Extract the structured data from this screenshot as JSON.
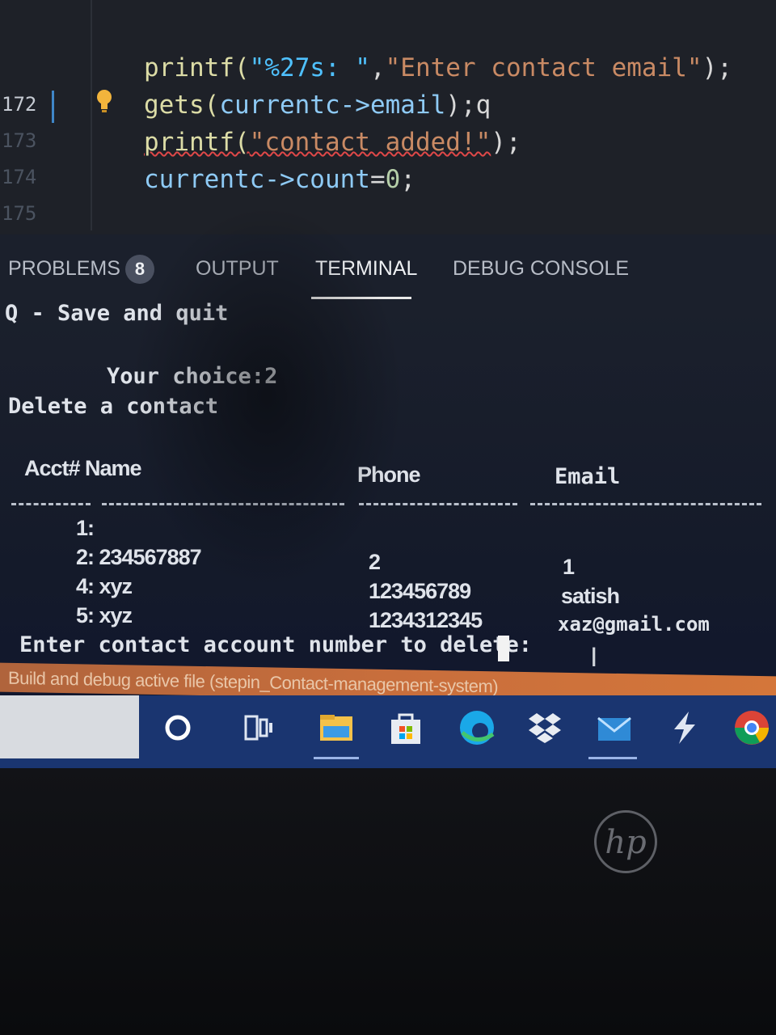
{
  "editor": {
    "line_numbers": [
      "172",
      "173",
      "174",
      "175"
    ],
    "code": {
      "line0_fn": "printf(",
      "line0_fmt": "\"%27s: \"",
      "line0_sep": ",",
      "line0_str": "\"Enter contact email\"",
      "line0_end": ");",
      "line1_fn": "gets(",
      "line1_var": "currentc->email",
      "line1_end": ");q",
      "line2_fn": "printf(",
      "line2_str": "\"contact added!\"",
      "line2_end": ");",
      "line3_var": "currentc->count",
      "line3_op": "=",
      "line3_num": "0",
      "line3_end": ";"
    }
  },
  "panel": {
    "tabs": [
      {
        "label": "PROBLEMS",
        "badge": "8"
      },
      {
        "label": "OUTPUT"
      },
      {
        "label": "TERMINAL"
      },
      {
        "label": "DEBUG CONSOLE"
      }
    ]
  },
  "terminal": {
    "menu_item": "Q - Save and quit",
    "choice_prompt": "Your choice:2",
    "heading": "Delete a contact",
    "columns": [
      "Acct# Name",
      "Phone",
      "Email"
    ],
    "rows": [
      {
        "acct_name": "1:",
        "phone": "",
        "email": ""
      },
      {
        "acct_name": "2: 234567887",
        "phone": "2",
        "email": "1"
      },
      {
        "acct_name": "4: xyz",
        "phone": "123456789",
        "email": "satish"
      },
      {
        "acct_name": "5: xyz",
        "phone": "1234312345",
        "email": "xaz@gmail.com"
      }
    ],
    "input_prompt": "Enter contact account number to delete:"
  },
  "status_bar": {
    "text": "Build and debug active file (stepin_Contact-management-system)"
  },
  "taskbar": {
    "icons": [
      "search-circle-icon",
      "task-view-icon",
      "file-explorer-icon",
      "store-icon",
      "edge-icon",
      "dropbox-icon",
      "mail-icon",
      "vscode-icon",
      "chrome-icon"
    ]
  },
  "laptop": {
    "brand": "hp"
  }
}
